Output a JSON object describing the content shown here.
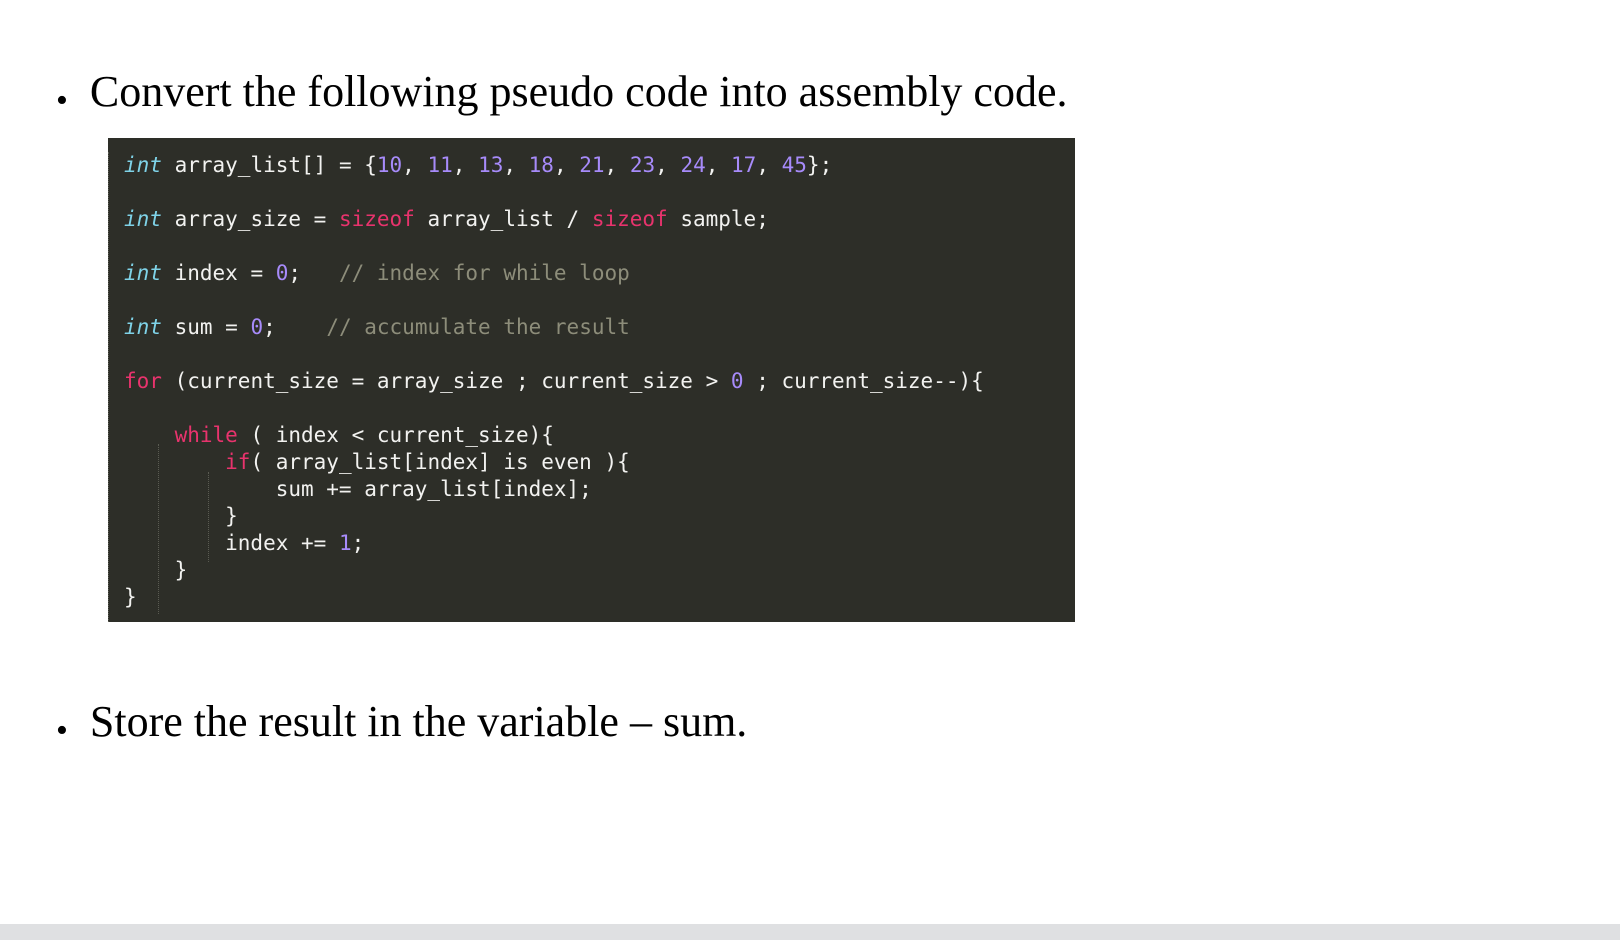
{
  "slide": {
    "background_color": "#ffffff",
    "bullets": [
      {
        "marker": "•",
        "text": "Convert the following pseudo code into assembly code."
      },
      {
        "marker": "•",
        "text": "Store the result in the variable – sum."
      }
    ],
    "code_block": {
      "background_color": "#2D2E28",
      "colors": {
        "type": "#7FD3E8",
        "keyword": "#E8336D",
        "number": "#A78BFA",
        "comment": "#8D8D7A",
        "plain": "#F2F2F0",
        "indent_guide": "#5A5B52"
      },
      "array_values": [
        10,
        11,
        13,
        18,
        21,
        23,
        24,
        17,
        45
      ],
      "lines": [
        {
          "id": "line-array-decl",
          "tokens": [
            {
              "cls": "t-type",
              "text": "int"
            },
            {
              "cls": "t-plain",
              "text": " array_list[] = {"
            },
            {
              "cls": "t-num",
              "text": "10"
            },
            {
              "cls": "t-plain",
              "text": ", "
            },
            {
              "cls": "t-num",
              "text": "11"
            },
            {
              "cls": "t-plain",
              "text": ", "
            },
            {
              "cls": "t-num",
              "text": "13"
            },
            {
              "cls": "t-plain",
              "text": ", "
            },
            {
              "cls": "t-num",
              "text": "18"
            },
            {
              "cls": "t-plain",
              "text": ", "
            },
            {
              "cls": "t-num",
              "text": "21"
            },
            {
              "cls": "t-plain",
              "text": ", "
            },
            {
              "cls": "t-num",
              "text": "23"
            },
            {
              "cls": "t-plain",
              "text": ", "
            },
            {
              "cls": "t-num",
              "text": "24"
            },
            {
              "cls": "t-plain",
              "text": ", "
            },
            {
              "cls": "t-num",
              "text": "17"
            },
            {
              "cls": "t-plain",
              "text": ", "
            },
            {
              "cls": "t-num",
              "text": "45"
            },
            {
              "cls": "t-plain",
              "text": "};"
            }
          ]
        },
        {
          "id": "line-blank-1",
          "tokens": []
        },
        {
          "id": "line-array-size",
          "tokens": [
            {
              "cls": "t-type",
              "text": "int"
            },
            {
              "cls": "t-plain",
              "text": " array_size = "
            },
            {
              "cls": "t-kw",
              "text": "sizeof"
            },
            {
              "cls": "t-plain",
              "text": " array_list / "
            },
            {
              "cls": "t-kw",
              "text": "sizeof"
            },
            {
              "cls": "t-plain",
              "text": " sample;"
            }
          ]
        },
        {
          "id": "line-blank-2",
          "tokens": []
        },
        {
          "id": "line-index-decl",
          "tokens": [
            {
              "cls": "t-type",
              "text": "int"
            },
            {
              "cls": "t-plain",
              "text": " index = "
            },
            {
              "cls": "t-num",
              "text": "0"
            },
            {
              "cls": "t-plain",
              "text": ";   "
            },
            {
              "cls": "t-comment",
              "text": "// index for while loop"
            }
          ]
        },
        {
          "id": "line-blank-3",
          "tokens": []
        },
        {
          "id": "line-sum-decl",
          "tokens": [
            {
              "cls": "t-type",
              "text": "int"
            },
            {
              "cls": "t-plain",
              "text": " sum = "
            },
            {
              "cls": "t-num",
              "text": "0"
            },
            {
              "cls": "t-plain",
              "text": ";    "
            },
            {
              "cls": "t-comment",
              "text": "// accumulate the result"
            }
          ]
        },
        {
          "id": "line-blank-4",
          "tokens": []
        },
        {
          "id": "line-for",
          "tokens": [
            {
              "cls": "t-kw",
              "text": "for"
            },
            {
              "cls": "t-plain",
              "text": " (current_size = array_size ; current_size > "
            },
            {
              "cls": "t-num",
              "text": "0"
            },
            {
              "cls": "t-plain",
              "text": " ; current_size--){"
            }
          ]
        },
        {
          "id": "line-blank-5",
          "tokens": []
        },
        {
          "id": "line-while",
          "tokens": [
            {
              "cls": "t-plain",
              "text": "    "
            },
            {
              "cls": "t-kw",
              "text": "while"
            },
            {
              "cls": "t-plain",
              "text": " ( index < current_size){"
            }
          ]
        },
        {
          "id": "line-if",
          "tokens": [
            {
              "cls": "t-plain",
              "text": "        "
            },
            {
              "cls": "t-kw",
              "text": "if"
            },
            {
              "cls": "t-plain",
              "text": "( array_list[index] is even ){"
            }
          ]
        },
        {
          "id": "line-sum-add",
          "tokens": [
            {
              "cls": "t-plain",
              "text": "            sum += array_list[index];"
            }
          ]
        },
        {
          "id": "line-close-if",
          "tokens": [
            {
              "cls": "t-plain",
              "text": "        }"
            }
          ]
        },
        {
          "id": "line-index-inc",
          "tokens": [
            {
              "cls": "t-plain",
              "text": "        index += "
            },
            {
              "cls": "t-num",
              "text": "1"
            },
            {
              "cls": "t-plain",
              "text": ";"
            }
          ]
        },
        {
          "id": "line-close-while",
          "tokens": [
            {
              "cls": "t-plain",
              "text": "    }"
            }
          ]
        },
        {
          "id": "line-close-for",
          "tokens": [
            {
              "cls": "t-plain",
              "text": "}"
            }
          ]
        }
      ]
    }
  }
}
